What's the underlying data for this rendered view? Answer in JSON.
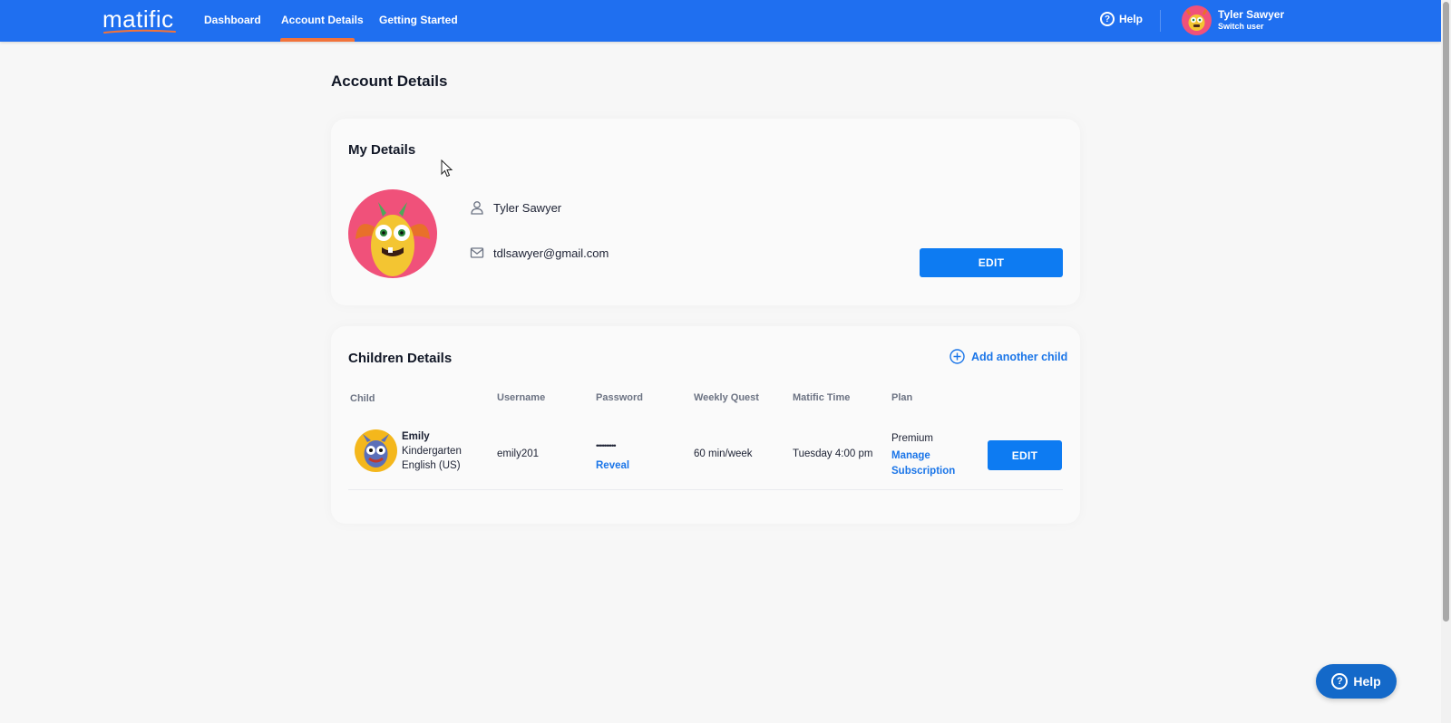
{
  "nav": {
    "logo": "matific",
    "links": [
      "Dashboard",
      "Account Details",
      "Getting Started"
    ],
    "help": "Help",
    "user_name": "Tyler Sawyer",
    "switch_user": "Switch user"
  },
  "page": {
    "title": "Account Details"
  },
  "my_details": {
    "title": "My Details",
    "name": "Tyler Sawyer",
    "email": "tdlsawyer@gmail.com",
    "edit_label": "EDIT"
  },
  "children": {
    "title": "Children Details",
    "add_label": "Add another child",
    "columns": [
      "Child",
      "Username",
      "Password",
      "Weekly Quest",
      "Matific Time",
      "Plan"
    ],
    "rows": [
      {
        "name": "Emily",
        "grade": "Kindergarten",
        "language": "English (US)",
        "username": "emily201",
        "password_mask": "••••••••••",
        "reveal": "Reveal",
        "weekly_quest": "60 min/week",
        "matific_time": "Tuesday 4:00 pm",
        "plan": "Premium",
        "manage_1": "Manage",
        "manage_2": "Subscription",
        "edit_label": "EDIT"
      }
    ]
  },
  "help_button": "Help",
  "colors": {
    "primary": "#1f6ff0",
    "button": "#0d7bf2",
    "accent": "#f2733a",
    "link": "#1a75e8"
  },
  "icons": [
    "help-icon",
    "user-icon",
    "mail-icon",
    "plus-circle-icon",
    "cursor-icon"
  ]
}
